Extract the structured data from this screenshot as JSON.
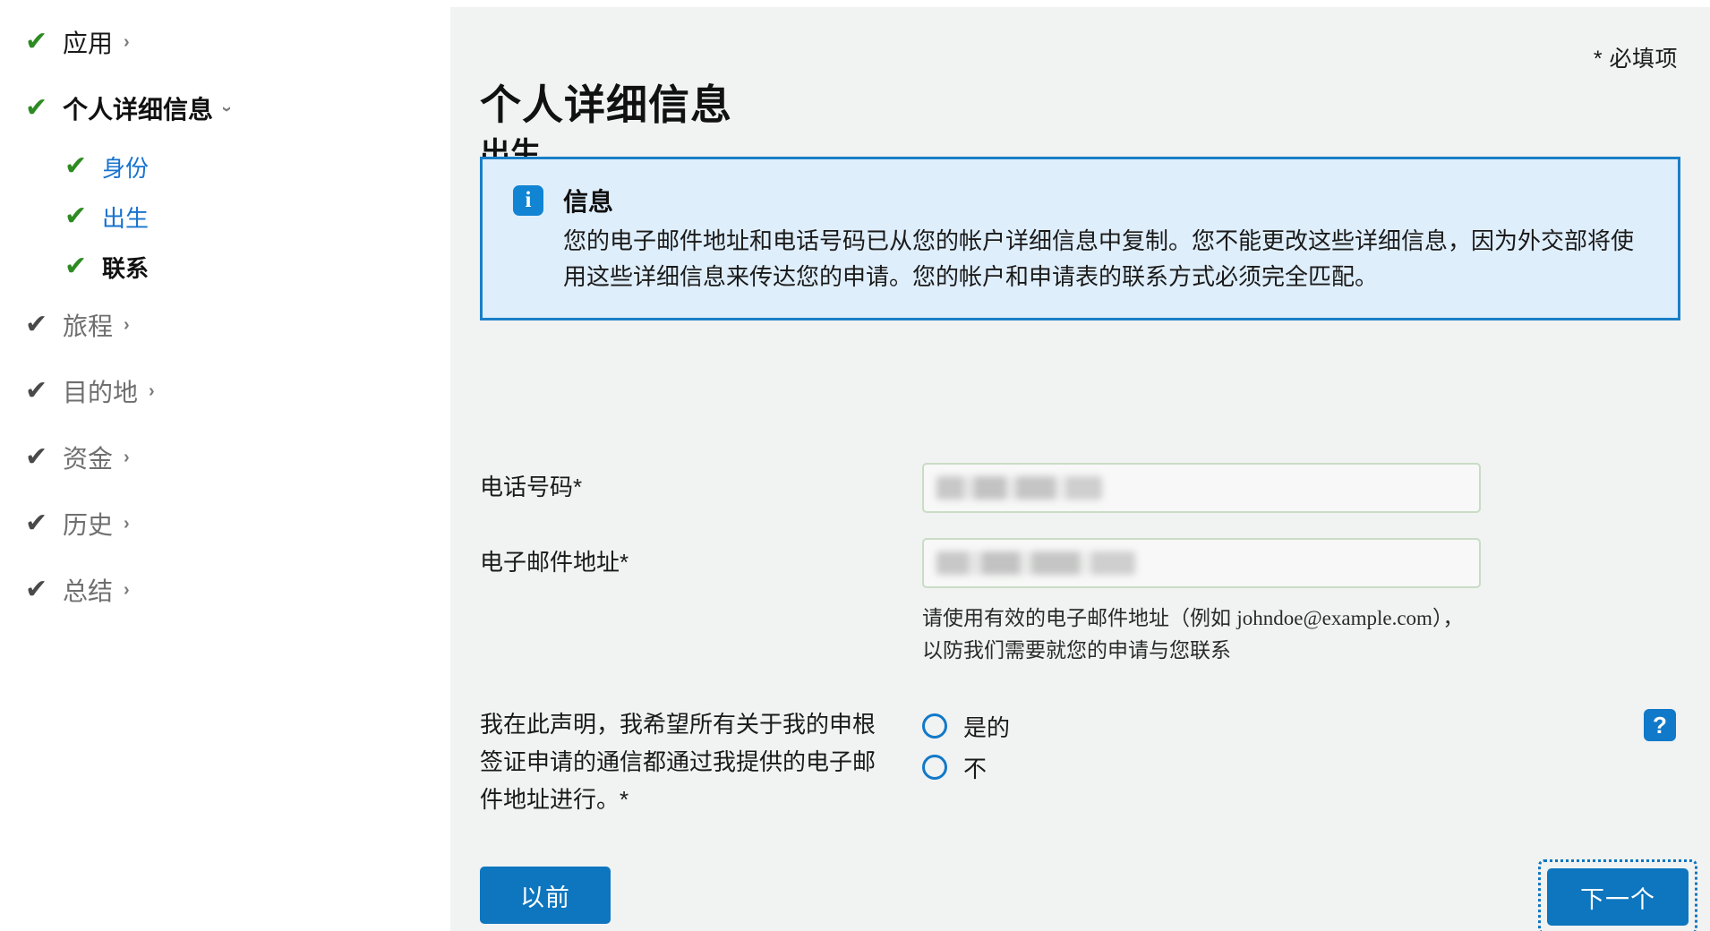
{
  "sidebar": {
    "items": [
      {
        "label": "应用",
        "tick": "green",
        "style": "dark",
        "chevron": "right",
        "level": "top"
      },
      {
        "label": "个人详细信息",
        "tick": "green",
        "style": "dark-bold",
        "chevron": "down",
        "level": "top"
      },
      {
        "label": "身份",
        "tick": "green",
        "style": "link",
        "chevron": "none",
        "level": "sub"
      },
      {
        "label": "出生",
        "tick": "green",
        "style": "link",
        "chevron": "none",
        "level": "sub"
      },
      {
        "label": "联系",
        "tick": "green",
        "style": "dark-bold",
        "chevron": "none",
        "level": "sub"
      },
      {
        "label": "旅程",
        "tick": "grey",
        "style": "grey",
        "chevron": "right",
        "level": "top"
      },
      {
        "label": "目的地",
        "tick": "grey",
        "style": "grey",
        "chevron": "right",
        "level": "top"
      },
      {
        "label": "资金",
        "tick": "grey",
        "style": "grey",
        "chevron": "right",
        "level": "top"
      },
      {
        "label": "历史",
        "tick": "grey",
        "style": "grey",
        "chevron": "right",
        "level": "top"
      },
      {
        "label": "总结",
        "tick": "grey",
        "style": "grey",
        "chevron": "right",
        "level": "top"
      }
    ],
    "tick_glyph": "✔",
    "chevron_right_glyph": "›",
    "chevron_down_glyph": "›"
  },
  "main": {
    "required_note": "* 必填项",
    "title": "个人详细信息",
    "subtitle": "出生",
    "info": {
      "icon": "info-icon",
      "icon_glyph": "i",
      "title": "信息",
      "body": "您的电子邮件地址和电话号码已从您的帐户详细信息中复制。您不能更改这些详细信息，因为外交部将使用这些详细信息来传达您的申请。您的帐户和申请表的联系方式必须完全匹配。"
    },
    "fields": {
      "phone": {
        "label": "电话号码*",
        "value": "",
        "placeholder": "",
        "redacted": true
      },
      "email": {
        "label": "电子邮件地址*",
        "value": "",
        "placeholder": "",
        "redacted": true,
        "help_line1_prefix": "请使用有效的电子邮件地址（例如 ",
        "help_sample": "johndoe@example.com",
        "help_line1_suffix": "），",
        "help_line2": "以防我们需要就您的申请与您联系"
      }
    },
    "declaration": {
      "label": "我在此声明，我希望所有关于我的申根签证申请的通信都通过我提供的电子邮件地址进行。*",
      "options": [
        {
          "label": "是的",
          "selected": false
        },
        {
          "label": "不",
          "selected": false
        }
      ],
      "help_button_glyph": "?"
    },
    "footer": {
      "previous_label": "以前",
      "next_label": "下一个",
      "next_focused": true
    }
  },
  "colors": {
    "accent_blue": "#0d76bf",
    "info_blue": "#1a7fc6",
    "info_bg": "#dfeefb",
    "tick_green": "#2e8b22",
    "panel_bg": "#f1f2f2",
    "input_border_green": "#cadcc6",
    "link_blue": "#1773cf"
  }
}
